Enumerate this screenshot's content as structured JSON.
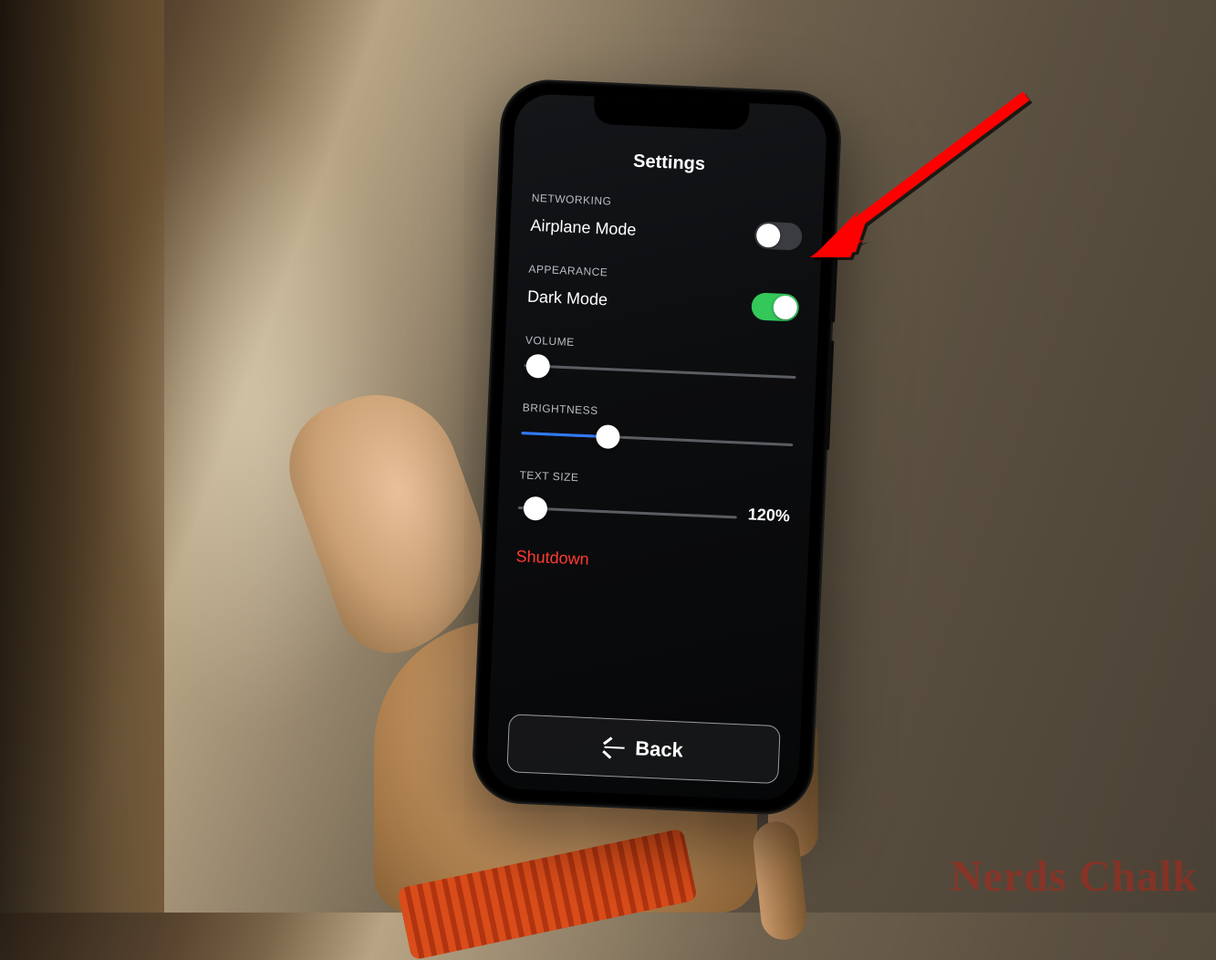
{
  "watermark": "Nerds Chalk",
  "screen": {
    "title": "Settings",
    "networking": {
      "section_label": "NETWORKING",
      "airplane_label": "Airplane Mode",
      "airplane_on": false
    },
    "appearance": {
      "section_label": "APPEARANCE",
      "dark_label": "Dark Mode",
      "dark_on": true
    },
    "volume": {
      "section_label": "VOLUME",
      "percent": 5
    },
    "brightness": {
      "section_label": "BRIGHTNESS",
      "percent": 32
    },
    "textsize": {
      "section_label": "TEXT SIZE",
      "percent": 8,
      "display": "120%"
    },
    "shutdown_label": "Shutdown",
    "back_label": "Back"
  },
  "annotation": {
    "arrow_color": "#ff0000",
    "points_to": "airplane-mode-toggle"
  }
}
